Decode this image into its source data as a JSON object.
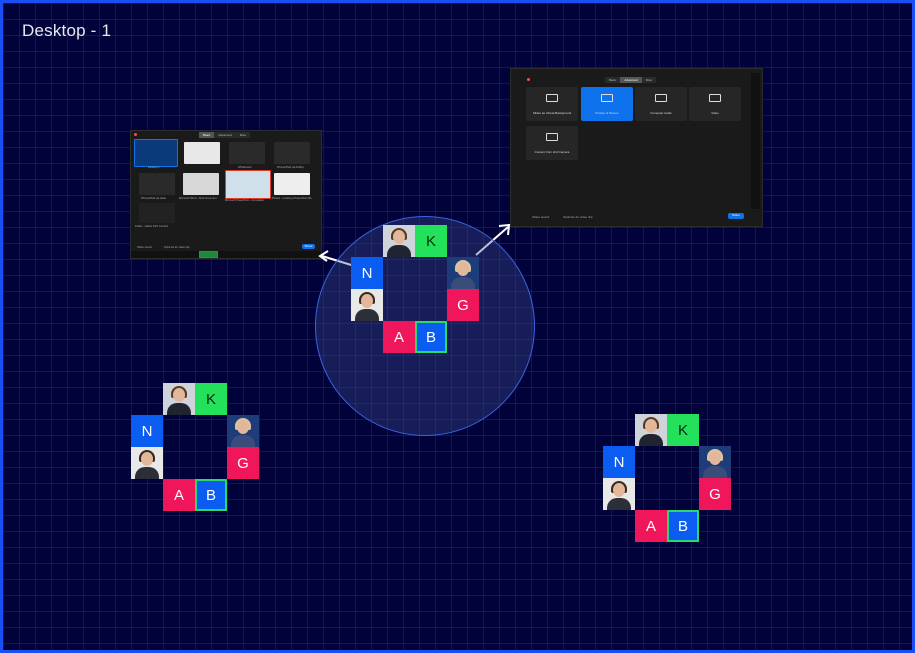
{
  "frame": {
    "title": "Desktop - 1"
  },
  "left_window": {
    "tabs": [
      "Basic",
      "Advanced",
      "Files"
    ],
    "thumb_labels": [
      "Desktop 1",
      "",
      "Whiteboard",
      "iPhone/iPad via AirPlay",
      "iPhone/iPad via cable",
      "Microsoft Word - Draft document",
      "Microsoft PowerPoint - Annotation",
      "Photos - Looking a PowerPoint file",
      "Folder - Adobe SVG Content"
    ],
    "footer_left": "Share sound",
    "footer_mid": "Optimize for video clip",
    "share_label": "Share"
  },
  "right_window": {
    "tabs": [
      "Basic",
      "Advanced",
      "Files"
    ],
    "options": [
      "Slides as Virtual Background",
      "Portion of Screen",
      "Computer Audio",
      "Video"
    ],
    "option2": "Content from 2nd Camera",
    "footer_left": "Share sound",
    "footer_mid": "Optimize for video clip",
    "share_label": "Share"
  },
  "clusters": [
    {
      "tiles": {
        "n": "N",
        "k": "K",
        "g": "G",
        "a": "A",
        "b": "B"
      }
    },
    {
      "tiles": {
        "n": "N",
        "k": "K",
        "g": "G",
        "a": "A",
        "b": "B"
      }
    },
    {
      "tiles": {
        "n": "N",
        "k": "K",
        "g": "G",
        "a": "A",
        "b": "B"
      }
    }
  ],
  "colors": {
    "frame_border": "#1a4ff5",
    "tile_blue": "#0b5cf0",
    "tile_green": "#23e15a",
    "tile_red": "#f0165b"
  }
}
